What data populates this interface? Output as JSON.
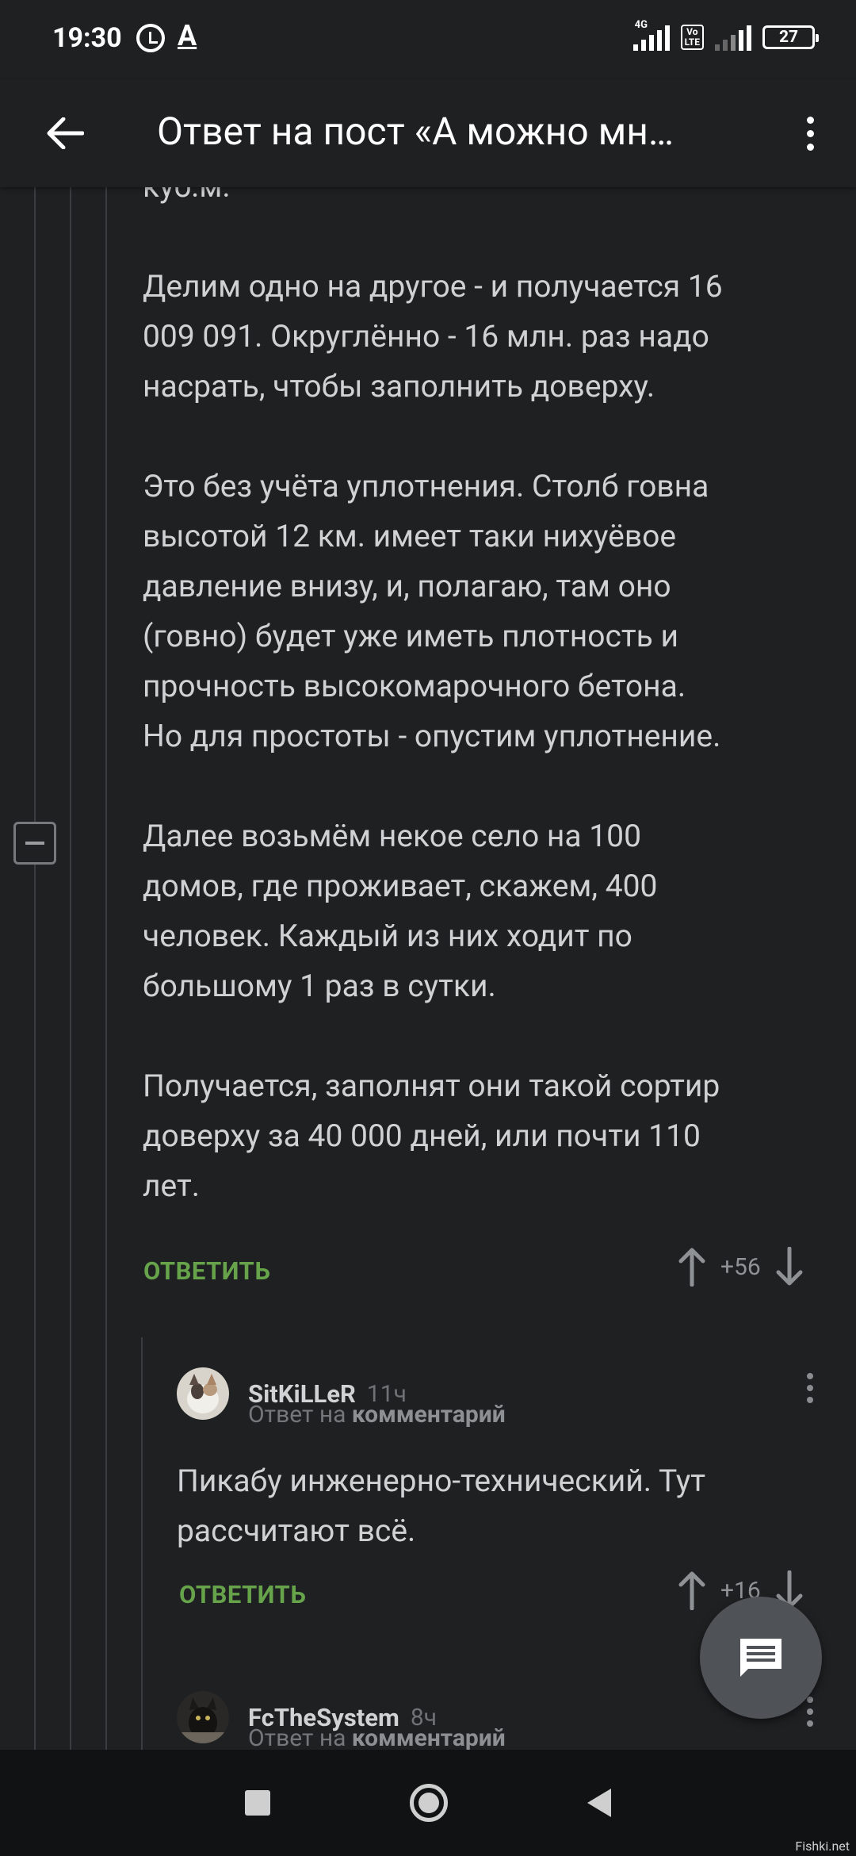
{
  "status_bar": {
    "time": "19:30",
    "a_indicator": "A",
    "network_label": "4G",
    "volte_label": "Vo\nLTE",
    "battery": "27"
  },
  "app_bar": {
    "title": "Ответ на пост «А можно мн…"
  },
  "comment": {
    "lines": [
      "куб.м.",
      "",
      "Делим одно на другое - и получается 16",
      "009 091. Округлённо - 16 млн. раз надо",
      "насрать, чтобы заполнить доверху.",
      "",
      "Это без учёта уплотнения. Столб говна",
      "высотой 12 км. имеет таки нихуёвое",
      "давление внизу, и, полагаю, там оно",
      "(говно) будет уже иметь плотность и",
      "прочность высокомарочного бетона.",
      "Но для простоты - опустим уплотнение.",
      "",
      "Далее возьмём некое село на 100",
      "домов, где проживает, скажем, 400",
      "человек. Каждый из них ходит по",
      "большому 1 раз в сутки.",
      "",
      "Получается, заполнят они такой сортир",
      "доверху за 40 000 дней, или почти 110",
      "лет."
    ],
    "reply_label": "ОТВЕТИТЬ",
    "votes": "+56"
  },
  "replies": [
    {
      "author": "SitKiLLeR",
      "time": "11ч",
      "reply_prefix": "Ответ на",
      "reply_target": "комментарий",
      "text_lines": [
        "Пикабу инженерно-технический. Тут",
        "рассчитают всё."
      ],
      "reply_label": "ОТВЕТИТЬ",
      "votes": "+16"
    },
    {
      "author": "FcTheSystem",
      "time": "8ч",
      "reply_prefix": "Ответ на",
      "reply_target": "комментарий"
    }
  ],
  "watermark": "Fishki.net",
  "colors": {
    "background": "#1e2022",
    "reply_green": "#66a34a",
    "fab": "#4f5256"
  },
  "icons": [
    "back-arrow-icon",
    "more-vert-icon",
    "collapse-minus-icon",
    "arrow-up-icon",
    "arrow-down-icon",
    "comment-fab-icon",
    "alarm-icon"
  ]
}
